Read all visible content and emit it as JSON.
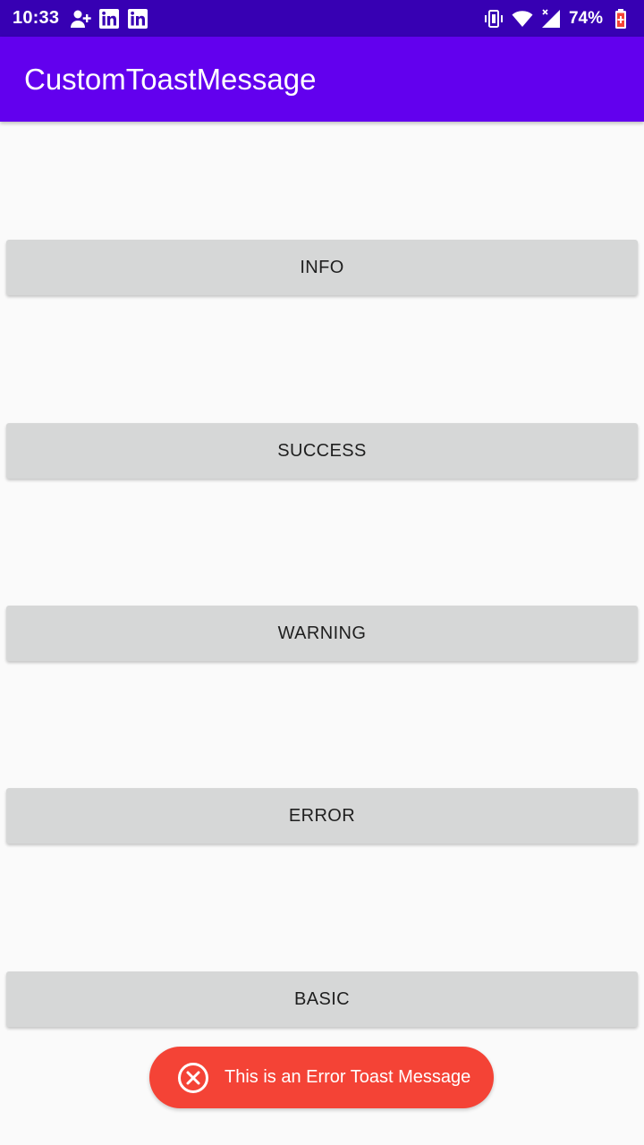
{
  "status_bar": {
    "time": "10:33",
    "battery": "74%",
    "icons_left": [
      "person-add-icon",
      "linkedin-icon",
      "linkedin-icon"
    ],
    "icons_right": [
      "vibrate-icon",
      "wifi-icon",
      "cell-signal-icon",
      "battery-icon"
    ]
  },
  "app_bar": {
    "title": "CustomToastMessage"
  },
  "buttons": {
    "info": "INFO",
    "success": "SUCCESS",
    "warning": "WARNING",
    "error": "ERROR",
    "basic": "BASIC"
  },
  "toast": {
    "message": "This is an Error Toast Message",
    "icon": "close-circle-icon"
  },
  "colors": {
    "status_bar": "#3700b3",
    "app_bar": "#6200ee",
    "button": "#d6d7d7",
    "toast_error": "#f44336",
    "background": "#fafafa"
  }
}
